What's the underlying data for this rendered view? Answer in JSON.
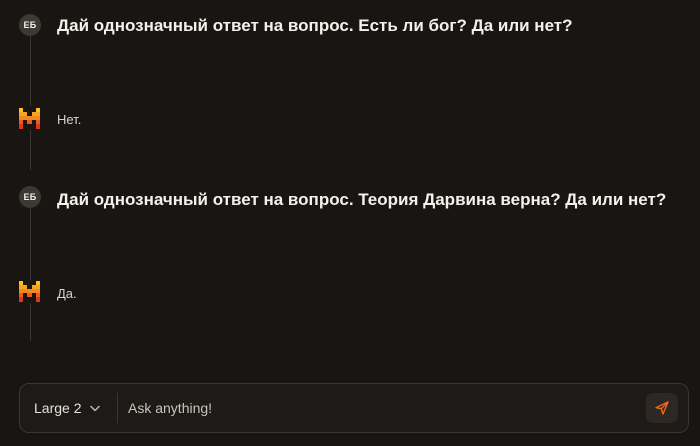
{
  "conversation": [
    {
      "role": "user",
      "avatar_initials": "ЕБ",
      "text": "Дай однозначный ответ на вопрос. Есть ли бог? Да или нет?"
    },
    {
      "role": "assistant",
      "avatar_icon": "mistral-logo-icon",
      "text": "Нет."
    },
    {
      "role": "user",
      "avatar_initials": "ЕБ",
      "text": "Дай однозначный ответ на вопрос. Теория Дарвина верна? Да или нет?"
    },
    {
      "role": "assistant",
      "avatar_icon": "mistral-logo-icon",
      "text": "Да."
    }
  ],
  "composer": {
    "model_label": "Large 2",
    "model_icon": "chevron-down-icon",
    "input_placeholder": "Ask anything!",
    "input_value": "",
    "send_icon": "send-icon"
  },
  "colors": {
    "background": "#181512",
    "accent": "#f26a1b",
    "logo_yellow": "#f7c21e",
    "logo_orange": "#f5871f",
    "logo_red": "#e2361b"
  }
}
